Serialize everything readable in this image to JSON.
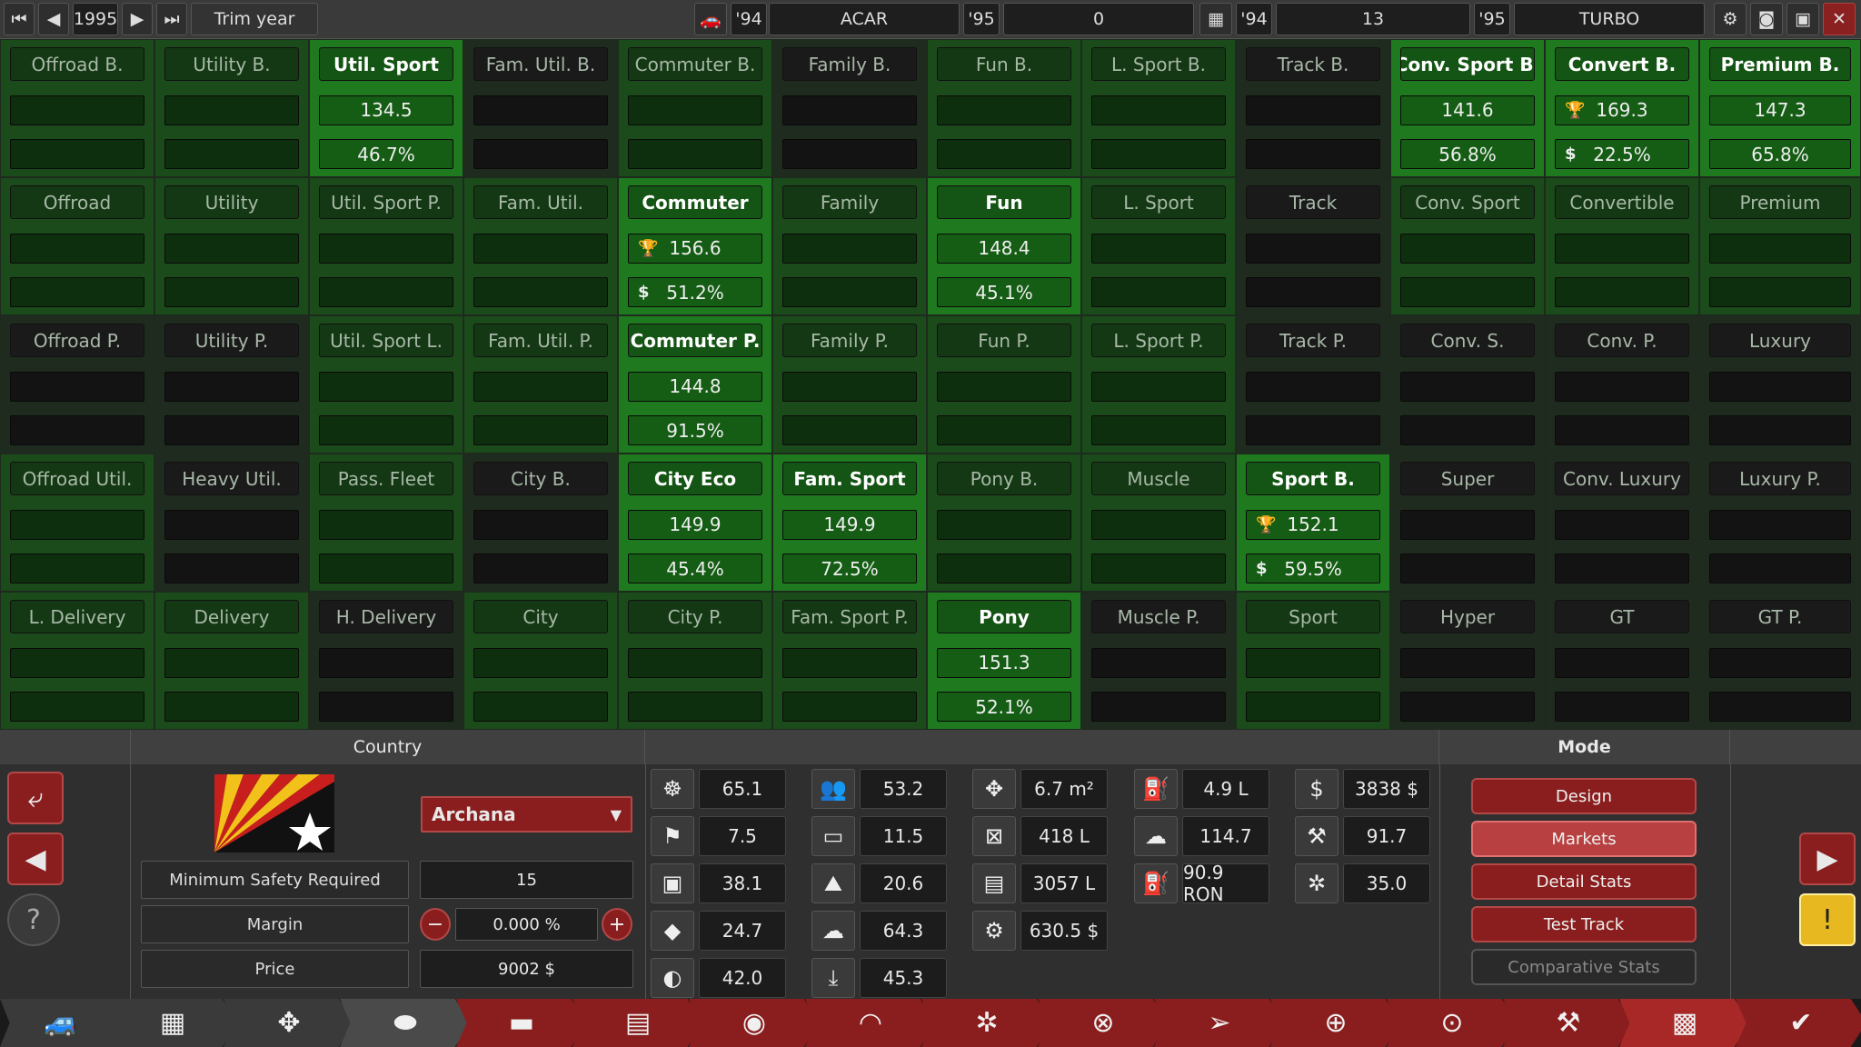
{
  "topbar": {
    "year": "1995",
    "trim_year": "Trim year",
    "car_year_a": "'94",
    "car_name": "ACAR",
    "car_year_b": "'95",
    "car_value": "0",
    "engine_year_a": "'94",
    "engine_value": "13",
    "engine_year_b": "'95",
    "engine_name": "TURBO"
  },
  "markets": [
    [
      {
        "label": "Offroad B.",
        "state": "dim"
      },
      {
        "label": "Utility B.",
        "state": "dim"
      },
      {
        "label": "Util. Sport",
        "state": "on",
        "val": "134.5",
        "pct": "46.7%"
      },
      {
        "label": "Fam. Util. B.",
        "state": "dark"
      },
      {
        "label": "Commuter B.",
        "state": "dim"
      },
      {
        "label": "Family B.",
        "state": "dark"
      },
      {
        "label": "Fun B.",
        "state": "dim"
      },
      {
        "label": "L. Sport B.",
        "state": "dim"
      },
      {
        "label": "Track B.",
        "state": "dark"
      },
      {
        "label": "Conv. Sport B.",
        "state": "on",
        "val": "141.6",
        "pct": "56.8%"
      },
      {
        "label": "Convert B.",
        "state": "on",
        "val": "169.3",
        "pct": "22.5%",
        "icons": true
      },
      {
        "label": "Premium B.",
        "state": "on",
        "val": "147.3",
        "pct": "65.8%"
      }
    ],
    [
      {
        "label": "Offroad",
        "state": "dim"
      },
      {
        "label": "Utility",
        "state": "dim"
      },
      {
        "label": "Util. Sport P.",
        "state": "dim"
      },
      {
        "label": "Fam. Util.",
        "state": "dim"
      },
      {
        "label": "Commuter",
        "state": "on",
        "val": "156.6",
        "pct": "51.2%",
        "icons": true
      },
      {
        "label": "Family",
        "state": "dim"
      },
      {
        "label": "Fun",
        "state": "on",
        "val": "148.4",
        "pct": "45.1%"
      },
      {
        "label": "L. Sport",
        "state": "dim"
      },
      {
        "label": "Track",
        "state": "dark"
      },
      {
        "label": "Conv. Sport",
        "state": "dim"
      },
      {
        "label": "Convertible",
        "state": "dim"
      },
      {
        "label": "Premium",
        "state": "dim"
      }
    ],
    [
      {
        "label": "Offroad P.",
        "state": "dark"
      },
      {
        "label": "Utility P.",
        "state": "dark"
      },
      {
        "label": "Util. Sport L.",
        "state": "dim"
      },
      {
        "label": "Fam. Util. P.",
        "state": "dim"
      },
      {
        "label": "Commuter P.",
        "state": "on",
        "val": "144.8",
        "pct": "91.5%"
      },
      {
        "label": "Family P.",
        "state": "dim"
      },
      {
        "label": "Fun P.",
        "state": "dim"
      },
      {
        "label": "L. Sport P.",
        "state": "dim"
      },
      {
        "label": "Track P.",
        "state": "dark"
      },
      {
        "label": "Conv. S.",
        "state": "dark"
      },
      {
        "label": "Conv. P.",
        "state": "dark"
      },
      {
        "label": "Luxury",
        "state": "dark"
      }
    ],
    [
      {
        "label": "Offroad Util.",
        "state": "dim"
      },
      {
        "label": "Heavy Util.",
        "state": "dark"
      },
      {
        "label": "Pass. Fleet",
        "state": "dim"
      },
      {
        "label": "City B.",
        "state": "dark"
      },
      {
        "label": "City Eco",
        "state": "on",
        "val": "149.9",
        "pct": "45.4%"
      },
      {
        "label": "Fam. Sport",
        "state": "on",
        "val": "149.9",
        "pct": "72.5%"
      },
      {
        "label": "Pony B.",
        "state": "dim"
      },
      {
        "label": "Muscle",
        "state": "dim"
      },
      {
        "label": "Sport B.",
        "state": "on",
        "val": "152.1",
        "pct": "59.5%",
        "icons": true
      },
      {
        "label": "Super",
        "state": "dark"
      },
      {
        "label": "Conv. Luxury",
        "state": "dark"
      },
      {
        "label": "Luxury P.",
        "state": "dark"
      }
    ],
    [
      {
        "label": "L. Delivery",
        "state": "dim"
      },
      {
        "label": "Delivery",
        "state": "dim"
      },
      {
        "label": "H. Delivery",
        "state": "dark"
      },
      {
        "label": "City",
        "state": "dim"
      },
      {
        "label": "City P.",
        "state": "dim"
      },
      {
        "label": "Fam. Sport P.",
        "state": "dim"
      },
      {
        "label": "Pony",
        "state": "on",
        "val": "151.3",
        "pct": "52.1%"
      },
      {
        "label": "Muscle P.",
        "state": "dark"
      },
      {
        "label": "Sport",
        "state": "dim"
      },
      {
        "label": "Hyper",
        "state": "dark"
      },
      {
        "label": "GT",
        "state": "dark"
      },
      {
        "label": "GT P.",
        "state": "dark"
      }
    ]
  ],
  "country": {
    "header": "Country",
    "selected": "Archana",
    "min_safety_label": "Minimum Safety Required",
    "min_safety_value": "15",
    "margin_label": "Margin",
    "margin_value": "0.000 %",
    "price_label": "Price",
    "price_value": "9002 $"
  },
  "stats": [
    {
      "icon": "steering-wheel-icon",
      "glyph": "☸",
      "value": "65.1"
    },
    {
      "icon": "checkered-flag-icon",
      "glyph": "⚑",
      "value": "7.5"
    },
    {
      "icon": "seat-icon",
      "glyph": "▣",
      "value": "38.1"
    },
    {
      "icon": "diamond-icon",
      "glyph": "◆",
      "value": "24.7"
    },
    {
      "icon": "safety-icon",
      "glyph": "◐",
      "value": "42.0"
    },
    {
      "icon": "passengers-icon",
      "glyph": "👥",
      "value": "53.2"
    },
    {
      "icon": "utility-truck-icon",
      "glyph": "▭",
      "value": "11.5"
    },
    {
      "icon": "offroad-icon",
      "glyph": "⛰",
      "value": "20.6"
    },
    {
      "icon": "emissions-icon",
      "glyph": "☁",
      "value": "64.3"
    },
    {
      "icon": "drivability-icon",
      "glyph": "⤓",
      "value": "45.3"
    },
    {
      "icon": "dimensions-icon",
      "glyph": "✥",
      "value": "6.7 m²"
    },
    {
      "icon": "cargo-icon",
      "glyph": "⊠",
      "value": "418 L"
    },
    {
      "icon": "passenger-volume-icon",
      "glyph": "▤",
      "value": "3057 L"
    },
    {
      "icon": "service-cost-icon",
      "glyph": "⚙",
      "value": "630.5 $"
    },
    {
      "icon": "fuel-tank-icon",
      "glyph": "⛽",
      "value": "4.9 L"
    },
    {
      "icon": "environment-icon",
      "glyph": "☁",
      "value": "114.7"
    },
    {
      "icon": "fuel-pump-icon",
      "glyph": "⛽",
      "value": "90.9 RON"
    },
    {
      "icon": "cost-icon",
      "glyph": "$",
      "value": "3838 $"
    },
    {
      "icon": "workbench-icon",
      "glyph": "⚒",
      "value": "91.7"
    },
    {
      "icon": "engineering-icon",
      "glyph": "✲",
      "value": "35.0"
    }
  ],
  "mode": {
    "header": "Mode",
    "buttons": [
      "Design",
      "Markets",
      "Detail Stats",
      "Test Track",
      "Comparative Stats"
    ]
  },
  "colors": {
    "on_bg": "#1f7a1f",
    "dim_bg": "#1b4a1b",
    "dark_bg": "#202b20",
    "accent_red": "#8a1e1e"
  }
}
